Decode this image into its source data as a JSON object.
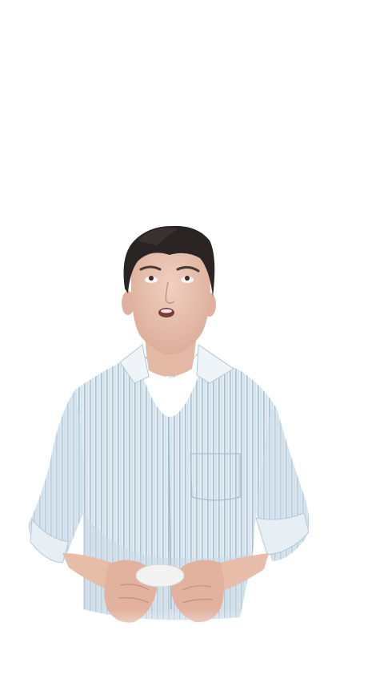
{
  "photo": {
    "background_color": "#ffffff",
    "subject": {
      "shirt_color": "#dce8f0",
      "shirt_stripe_color": "#9fb7c9",
      "undershirt_color": "#ffffff",
      "hair_color": "#2a2424",
      "skin_color": "#e9c3b2"
    }
  }
}
